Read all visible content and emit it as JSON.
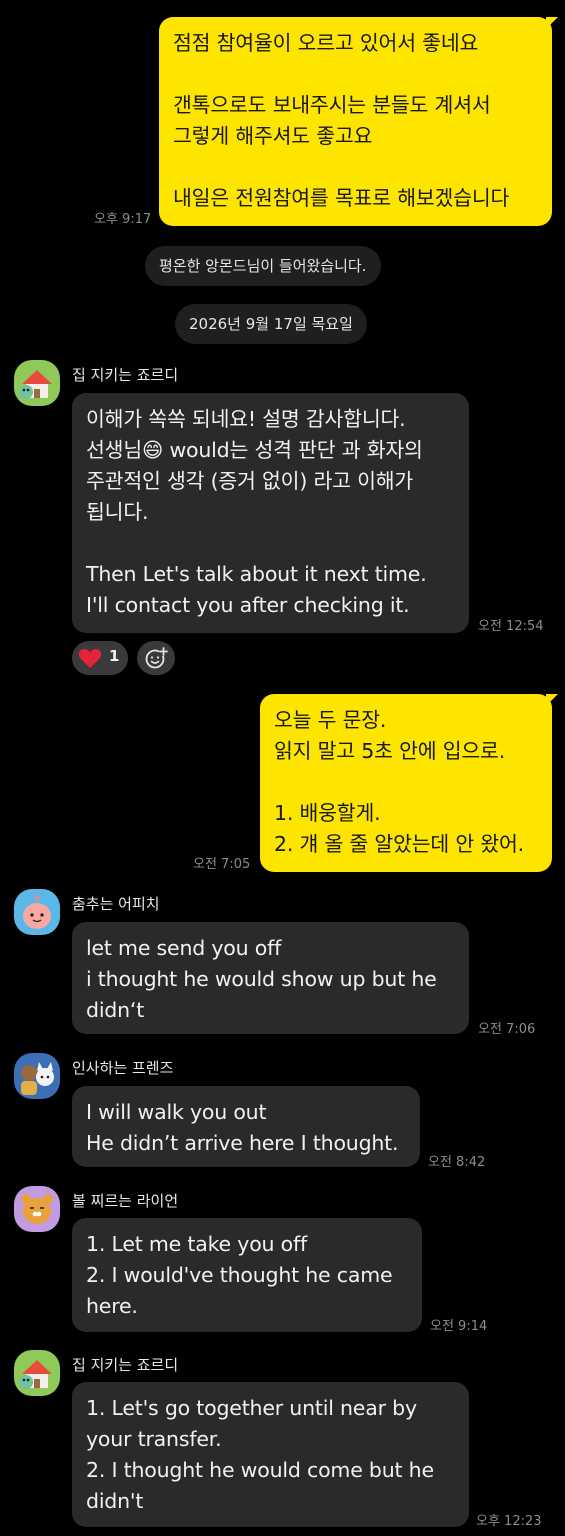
{
  "messages": [
    {
      "sent_time": "오후 9:17",
      "text": "점점 참여율이 오르고 있어서 좋네요\n\n갠톡으로도 보내주시는 분들도 계셔서\n그렇게 해주셔도 좋고요\n\n내일은 전원참여를 목표로 해보겠습니다"
    },
    {
      "sender": "집 지키는 죠르디",
      "time": "오전 12:54",
      "text": "이해가 쏙쏙 되네요! 설명 감사합니다.\n선생님😄 would는 성격 판단 과 화자의\n주관적인 생각 (증거 없이) 라고 이해가\n됩니다.\n\nThen Let's talk about it next time.\nI'll contact you after checking it.",
      "reactions": {
        "heart_count": "1"
      }
    },
    {
      "sent_time": "오전 7:05",
      "text": "오늘 두 문장.\n읽지 말고 5초 안에 입으로.\n\n1. 배웅할게.\n2. 걔 올 줄 알았는데 안 왔어."
    },
    {
      "sender": "춤추는 어피치",
      "time": "오전 7:06",
      "text": "let me send you off\ni thought he would show up but he\ndidn‘t"
    },
    {
      "sender": "인사하는 프렌즈",
      "time": "오전 8:42",
      "text": "I will walk you out\nHe didn’t arrive here I thought."
    },
    {
      "sender": "볼 찌르는 라이언",
      "time": "오전 9:14",
      "text": "1. Let me take you off\n2. I would've thought he came\nhere."
    },
    {
      "sender": "집 지키는 죠르디",
      "time": "오후 12:23",
      "text": "1. Let's go together until near by\nyour transfer.\n2. I thought he would come but he\ndidn't"
    }
  ],
  "notices": {
    "joined": "평온한 앙몬드님이 들어왔습니다.",
    "date": "2026년 9월 17일 목요일"
  },
  "colors": {
    "background": "#000000",
    "outgoing_bubble": "#FEE500",
    "incoming_bubble": "#2A2A2C",
    "heart": "#E5243B"
  },
  "icons": [
    "jordy-avatar-icon",
    "apeach-avatar-icon",
    "friends-avatar-icon",
    "ryan-avatar-icon",
    "heart-icon",
    "add-reaction-icon"
  ]
}
